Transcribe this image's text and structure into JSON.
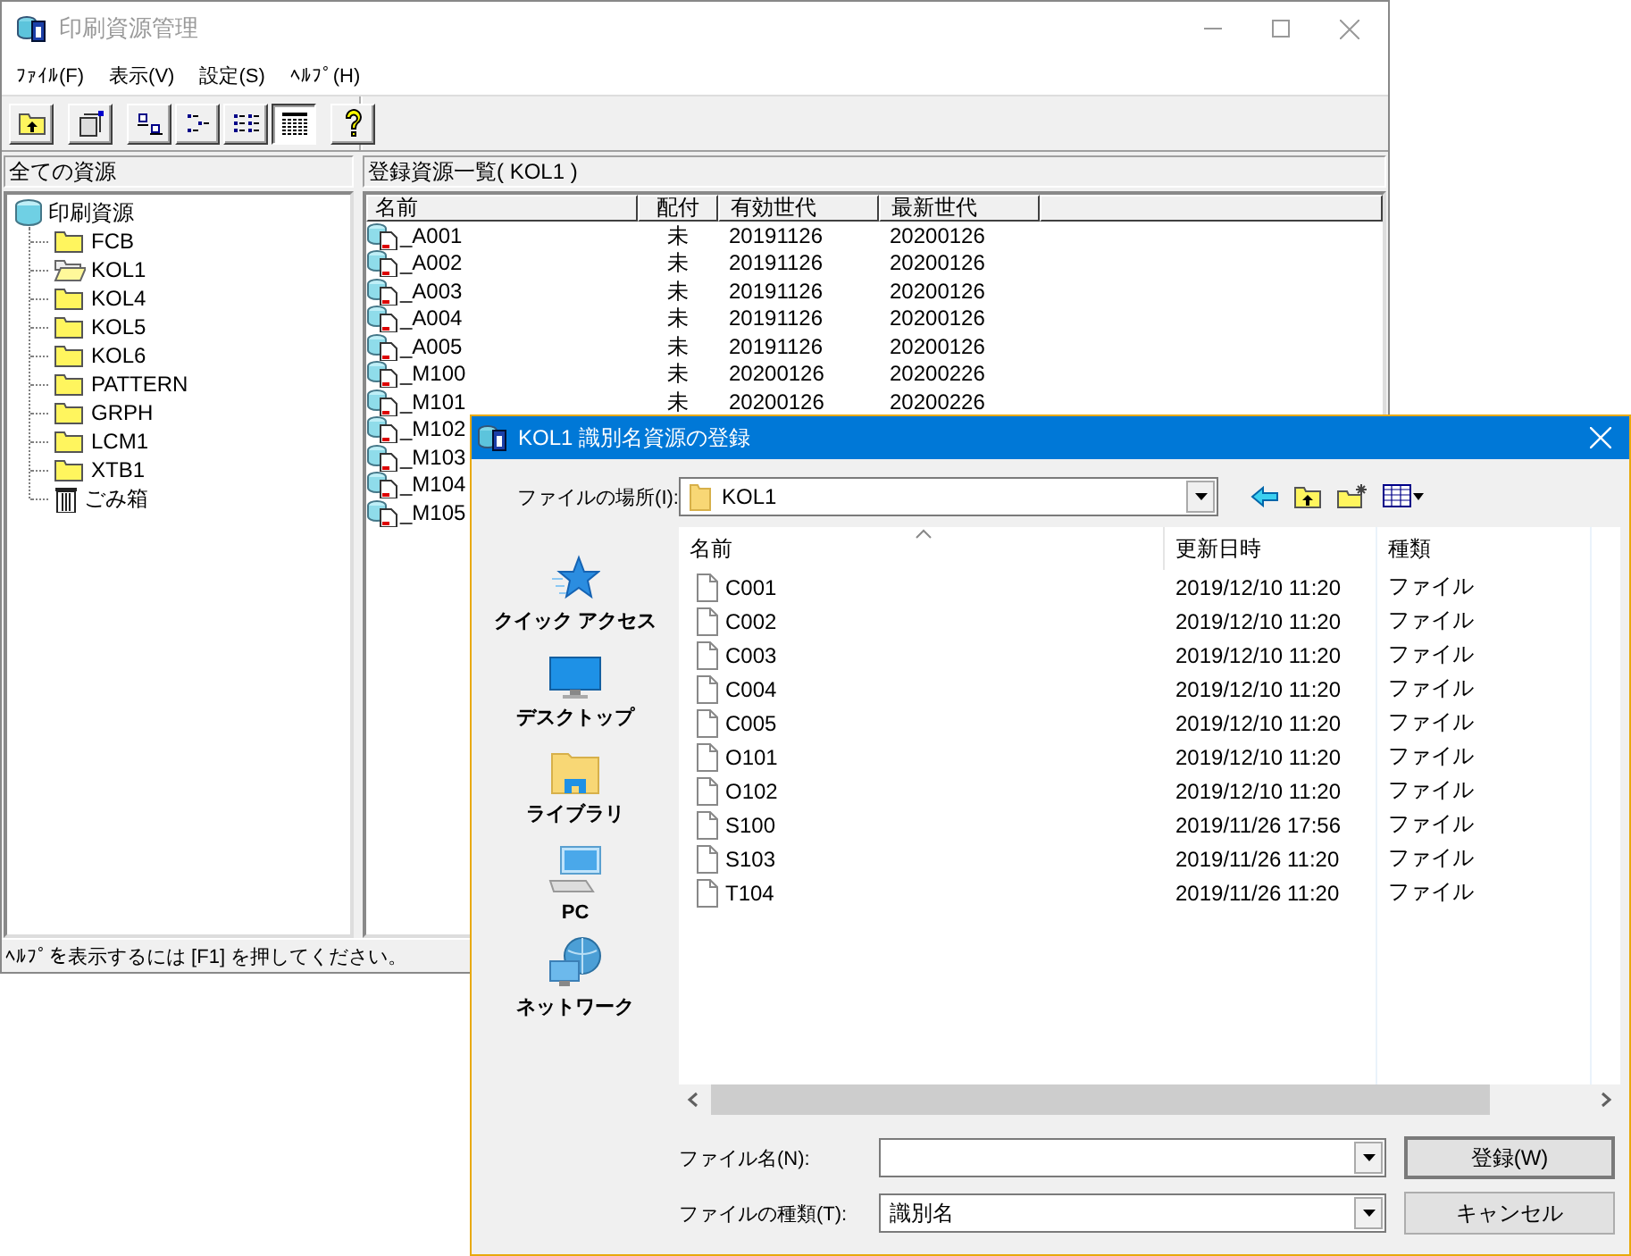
{
  "main_window": {
    "title": "印刷資源管理",
    "menu": [
      "ﾌｧｲﾙ(F)",
      "表示(V)",
      "設定(S)",
      "ﾍﾙﾌﾟ(H)"
    ],
    "toolbar": [
      [
        {
          "kind": "up-folder",
          "pressed": false
        }
      ],
      [
        {
          "kind": "properties",
          "pressed": false
        }
      ],
      [
        {
          "kind": "large-icons",
          "pressed": false
        },
        {
          "kind": "small-icons",
          "pressed": false
        },
        {
          "kind": "list",
          "pressed": false
        },
        {
          "kind": "details",
          "pressed": true
        }
      ],
      [
        {
          "kind": "help",
          "pressed": false
        }
      ]
    ],
    "tree": {
      "header": "全ての資源",
      "root": {
        "label": "印刷資源",
        "children": [
          {
            "label": "FCB",
            "kind": "folder",
            "open": false
          },
          {
            "label": "KOL1",
            "kind": "folder",
            "open": true
          },
          {
            "label": "KOL4",
            "kind": "folder",
            "open": false
          },
          {
            "label": "KOL5",
            "kind": "folder",
            "open": false
          },
          {
            "label": "KOL6",
            "kind": "folder",
            "open": false
          },
          {
            "label": "PATTERN",
            "kind": "folder",
            "open": false
          },
          {
            "label": "GRPH",
            "kind": "folder",
            "open": false
          },
          {
            "label": "LCM1",
            "kind": "folder",
            "open": false
          },
          {
            "label": "XTB1",
            "kind": "folder",
            "open": false
          },
          {
            "label": "ごみ箱",
            "kind": "trash",
            "open": false
          }
        ]
      }
    },
    "list": {
      "header": "登録資源一覧( KOL1 )",
      "columns": [
        "名前",
        "配付",
        "有効世代",
        "最新世代"
      ],
      "rows": [
        {
          "name": "_A001",
          "distribution": "未",
          "valid_generation": "20191126",
          "latest_generation": "20200126"
        },
        {
          "name": "_A002",
          "distribution": "未",
          "valid_generation": "20191126",
          "latest_generation": "20200126"
        },
        {
          "name": "_A003",
          "distribution": "未",
          "valid_generation": "20191126",
          "latest_generation": "20200126"
        },
        {
          "name": "_A004",
          "distribution": "未",
          "valid_generation": "20191126",
          "latest_generation": "20200126"
        },
        {
          "name": "_A005",
          "distribution": "未",
          "valid_generation": "20191126",
          "latest_generation": "20200126"
        },
        {
          "name": "_M100",
          "distribution": "未",
          "valid_generation": "20200126",
          "latest_generation": "20200226"
        },
        {
          "name": "_M101",
          "distribution": "未",
          "valid_generation": "20200126",
          "latest_generation": "20200226"
        },
        {
          "name": "_M102"
        },
        {
          "name": "_M103"
        },
        {
          "name": "_M104"
        },
        {
          "name": "_M105"
        }
      ]
    },
    "status_bar": "ﾍﾙﾌﾟを表示するには [F1] を押してください。"
  },
  "dialog": {
    "title": "KOL1 識別名資源の登録",
    "location_label": "ファイルの場所(I):",
    "location": "KOL1",
    "places": [
      {
        "kind": "quick-access",
        "label": "クイック アクセス"
      },
      {
        "kind": "desktop",
        "label": "デスクトップ"
      },
      {
        "kind": "library",
        "label": "ライブラリ"
      },
      {
        "kind": "pc",
        "label": "PC"
      },
      {
        "kind": "network",
        "label": "ネットワーク"
      }
    ],
    "columns": [
      {
        "label": "名前",
        "sorted": true
      },
      {
        "label": "更新日時",
        "sorted": false
      },
      {
        "label": "種類",
        "sorted": false
      }
    ],
    "files": [
      {
        "name": "C001",
        "modified": "2019/12/10 11:20",
        "type": "ファイル"
      },
      {
        "name": "C002",
        "modified": "2019/12/10 11:20",
        "type": "ファイル"
      },
      {
        "name": "C003",
        "modified": "2019/12/10 11:20",
        "type": "ファイル"
      },
      {
        "name": "C004",
        "modified": "2019/12/10 11:20",
        "type": "ファイル"
      },
      {
        "name": "C005",
        "modified": "2019/12/10 11:20",
        "type": "ファイル"
      },
      {
        "name": "O101",
        "modified": "2019/12/10 11:20",
        "type": "ファイル"
      },
      {
        "name": "O102",
        "modified": "2019/12/10 11:20",
        "type": "ファイル"
      },
      {
        "name": "S100",
        "modified": "2019/11/26 17:56",
        "type": "ファイル"
      },
      {
        "name": "S103",
        "modified": "2019/11/26 11:20",
        "type": "ファイル"
      },
      {
        "name": "T104",
        "modified": "2019/11/26 11:20",
        "type": "ファイル"
      }
    ],
    "file_name_label": "ファイル名(N):",
    "file_type_label": "ファイルの種類(T):",
    "file_type": "識別名",
    "buttons": [
      "登録(W)",
      "キャンセル"
    ]
  }
}
